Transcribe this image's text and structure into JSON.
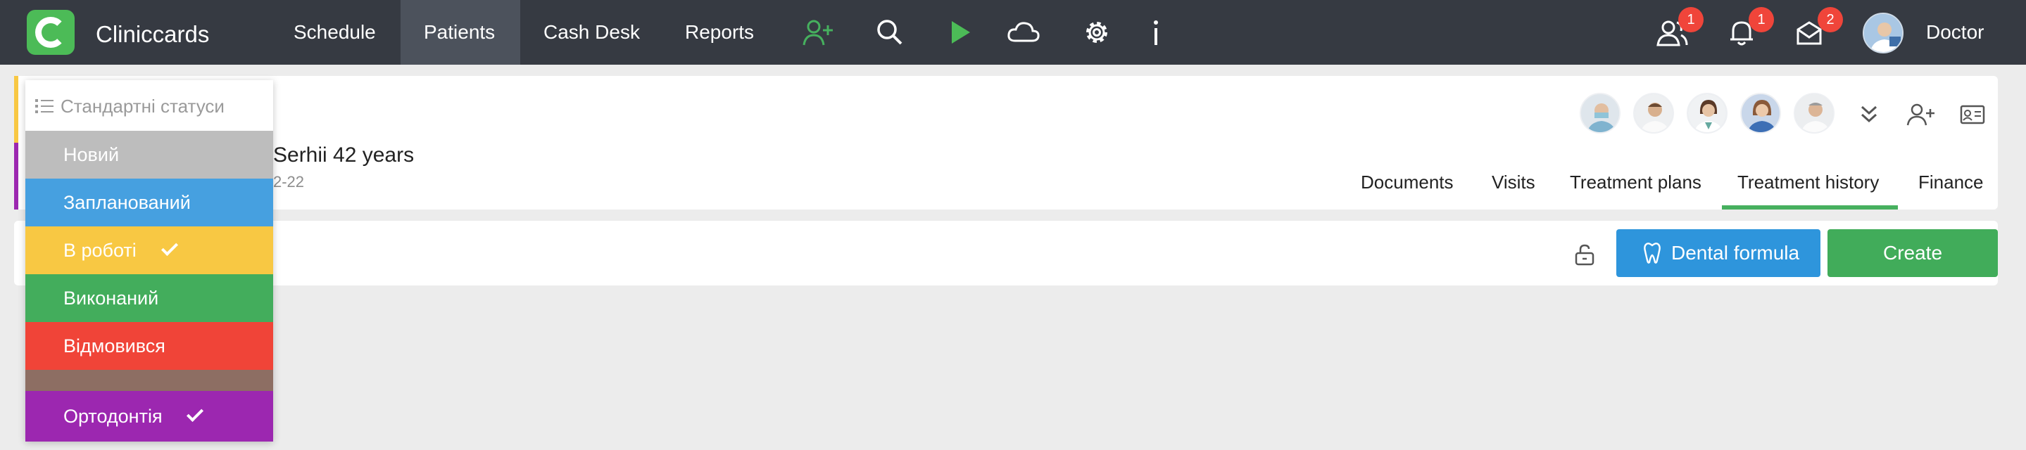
{
  "app": {
    "brand": "Cliniccards"
  },
  "nav": {
    "links": [
      "Schedule",
      "Patients",
      "Cash Desk",
      "Reports"
    ],
    "active": "Patients",
    "icons": [
      "add-user-icon",
      "search-icon",
      "play-icon",
      "cloud-icon",
      "gear-icon",
      "info-icon"
    ]
  },
  "header_right": {
    "users_badge": "1",
    "bell_badge": "1",
    "mail_badge": "2",
    "user_name": "Doctor"
  },
  "patient": {
    "name_partial": "Serhii  42 years",
    "dob_partial": "2-22"
  },
  "tabs": [
    "Documents",
    "Visits",
    "Treatment plans",
    "Treatment history",
    "Finance"
  ],
  "active_tab": "Treatment history",
  "actions": {
    "dental_formula": "Dental formula",
    "create": "Create"
  },
  "status_dropdown": {
    "header": "Стандартні статуси",
    "items": [
      {
        "label": "Новий",
        "color": "#bdbdbd",
        "checked": false
      },
      {
        "label": "Запланований",
        "color": "#46a0e0",
        "checked": false
      },
      {
        "label": "В роботі",
        "color": "#f8c843",
        "checked": true
      },
      {
        "label": "Виконаний",
        "color": "#43ad5c",
        "checked": false
      },
      {
        "label": "Відмовився",
        "color": "#f04438",
        "checked": false
      },
      {
        "label": "",
        "color": "#8d6e63",
        "checked": false
      },
      {
        "label": "Ортодонтія",
        "color": "#9c27b0",
        "checked": true
      }
    ]
  },
  "colors": {
    "navbar": "#363a42",
    "accent_green": "#46b05e",
    "accent_blue": "#2e95dc"
  }
}
